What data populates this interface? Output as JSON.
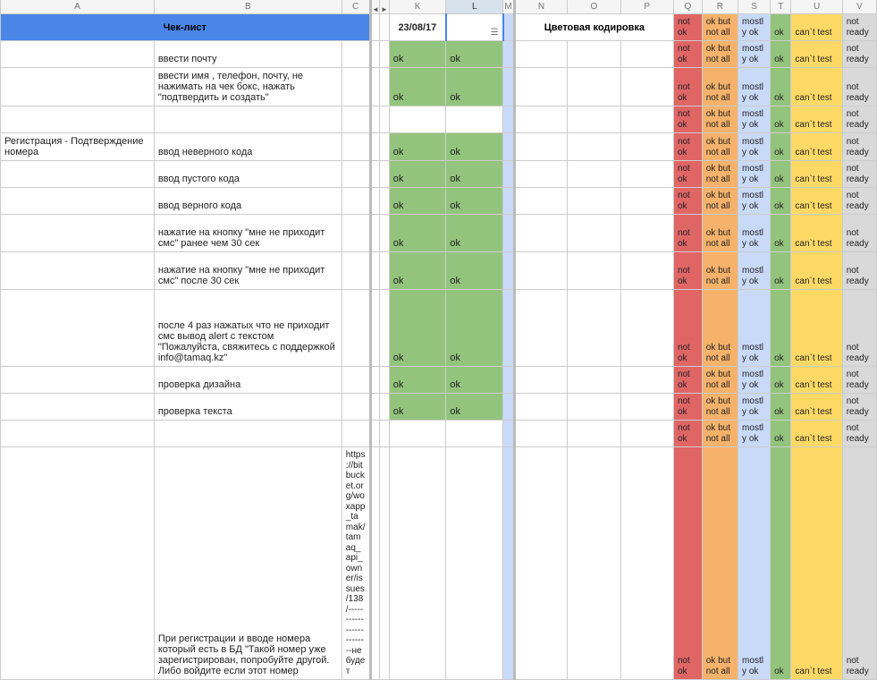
{
  "cols": {
    "A": "A",
    "B": "B",
    "C": "C",
    "ctrl1": "◄",
    "ctrl2": "►",
    "K": "K",
    "L": "L",
    "M": "M",
    "N": "N",
    "O": "O",
    "P": "P",
    "Q": "Q",
    "R": "R",
    "S": "S",
    "T": "T",
    "U": "U",
    "V": "V"
  },
  "header": {
    "checklist": "Чек-лист",
    "date": "23/08/17",
    "color_coding": "Цветовая кодировка"
  },
  "status": {
    "notok": "not ok",
    "okbut": "ok but not all",
    "mostly": "mostly ok",
    "ok": "ok",
    "cant": "can`t test",
    "notrdy": "not ready"
  },
  "section": {
    "reg_confirm": "Регистрация - Подтверждение номера"
  },
  "rows": [
    {
      "b": "ввести почту",
      "k": "ok",
      "l": "ok"
    },
    {
      "b": "ввести имя , телефон, почту, не нажимать на чек бокс, нажать \"подтвердить и создать\"",
      "k": "ok",
      "l": "ok"
    },
    {
      "b": "",
      "k": "",
      "l": ""
    },
    {
      "b": "ввод неверного кода",
      "k": "ok",
      "l": "ok"
    },
    {
      "b": "ввод пустого кода",
      "k": "ok",
      "l": "ok"
    },
    {
      "b": "ввод верного кода",
      "k": "ok",
      "l": "ok"
    },
    {
      "b": "нажатие на кнопку \"мне не приходит смс\" ранее чем 30 сек",
      "k": "ok",
      "l": "ok"
    },
    {
      "b": "нажатие на кнопку \"мне не приходит смс\" после 30 сек",
      "k": "ok",
      "l": "ok"
    },
    {
      "b": "после 4 раз нажатых что не приходит смс вывод alert с текстом \"Пожалуйста, свяжитесь с поддержкой info@tamaq.kz\"",
      "k": "ok",
      "l": "ok"
    },
    {
      "b": "проверка дизайна",
      "k": "ok",
      "l": "ok"
    },
    {
      "b": "проверка текста",
      "k": "ok",
      "l": "ok"
    },
    {
      "b": "",
      "k": "",
      "l": ""
    },
    {
      "b": "При регистрации и вводе номера который есть в БД  \"Такой номер уже зарегистрирован, попробуйте другой. Либо войдите если этот номер",
      "c": "https://bitbucket.org/woxapp_tamak/tamaq_api_owner/issues/138/-------------------------не будет",
      "k": "",
      "l": ""
    }
  ],
  "chart_data": {
    "type": "table",
    "title": "Чек-лист / Цветовая кодировка",
    "date": "23/08/17",
    "legend": [
      "not ok",
      "ok but not all",
      "mostly ok",
      "ok",
      "can`t test",
      "not ready"
    ],
    "section": "Регистрация - Подтверждение номера",
    "items": [
      {
        "desc": "ввести почту",
        "K": "ok",
        "L": "ok"
      },
      {
        "desc": "ввести имя , телефон, почту, не нажимать на чек бокс, нажать \"подтвердить и создать\"",
        "K": "ok",
        "L": "ok"
      },
      {
        "desc": "",
        "K": "",
        "L": ""
      },
      {
        "desc": "ввод неверного кода",
        "K": "ok",
        "L": "ok"
      },
      {
        "desc": "ввод пустого кода",
        "K": "ok",
        "L": "ok"
      },
      {
        "desc": "ввод верного кода",
        "K": "ok",
        "L": "ok"
      },
      {
        "desc": "нажатие на кнопку \"мне не приходит смс\" ранее чем 30 сек",
        "K": "ok",
        "L": "ok"
      },
      {
        "desc": "нажатие на кнопку \"мне не приходит смс\" после 30 сек",
        "K": "ok",
        "L": "ok"
      },
      {
        "desc": "после 4 раз нажатых что не приходит смс вывод alert с текстом \"Пожалуйста, свяжитесь с поддержкой info@tamaq.kz\"",
        "K": "ok",
        "L": "ok"
      },
      {
        "desc": "проверка дизайна",
        "K": "ok",
        "L": "ok"
      },
      {
        "desc": "проверка текста",
        "K": "ok",
        "L": "ok"
      },
      {
        "desc": "",
        "K": "",
        "L": ""
      },
      {
        "desc": "При регистрации и вводе номера который есть в БД  \"Такой номер уже зарегистрирован, попробуйте другой. Либо войдите если этот номер",
        "note": "https://bitbucket.org/woxapp_tamak/tamaq_api_owner/issues/138/-------------------------не будет",
        "K": "",
        "L": ""
      }
    ]
  }
}
